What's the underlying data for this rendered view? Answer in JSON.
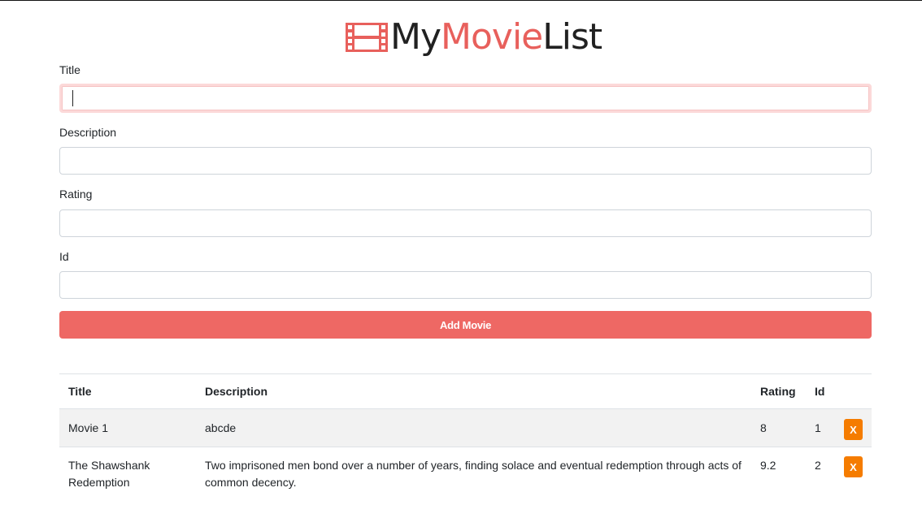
{
  "brand": {
    "part1": "My",
    "part2": "Movie",
    "part3": "List",
    "accent_color": "#e8605c",
    "icon": "film-strip-icon"
  },
  "form": {
    "fields": [
      {
        "label": "Title",
        "value": "",
        "placeholder": ""
      },
      {
        "label": "Description",
        "value": "",
        "placeholder": ""
      },
      {
        "label": "Rating",
        "value": "",
        "placeholder": ""
      },
      {
        "label": "Id",
        "value": "",
        "placeholder": ""
      }
    ],
    "submit_label": "Add Movie"
  },
  "table": {
    "headers": [
      "Title",
      "Description",
      "Rating",
      "Id",
      ""
    ],
    "rows": [
      {
        "title": "Movie 1",
        "description": "abcde",
        "rating": "8",
        "id": "1",
        "delete_label": "X"
      },
      {
        "title": "The Shawshank Redemption",
        "description": "Two imprisoned men bond over a number of years, finding solace and eventual redemption through acts of common decency.",
        "rating": "9.2",
        "id": "2",
        "delete_label": "X"
      }
    ]
  },
  "colors": {
    "primary_button": "#ee6864",
    "delete_button": "#f57c00"
  }
}
